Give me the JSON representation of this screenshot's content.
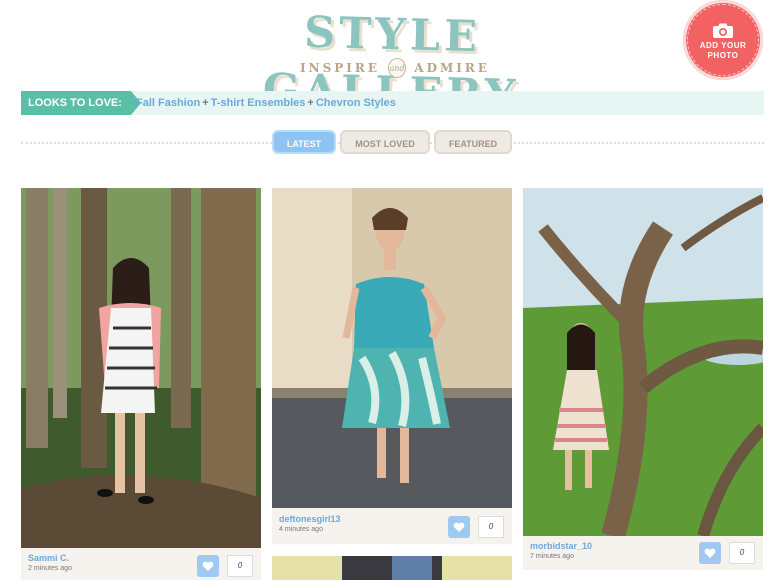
{
  "header": {
    "title": "STYLE GALLERY",
    "tagline_left": "INSPIRE",
    "tagline_mid": "and",
    "tagline_right": "ADMIRE"
  },
  "add_photo": {
    "label": "ADD YOUR PHOTO",
    "icon": "camera-icon"
  },
  "looks": {
    "label": "LOOKS TO LOVE:",
    "links": [
      "Fall Fashion",
      "T-shirt Ensembles",
      "Chevron Styles"
    ],
    "separator": "+"
  },
  "tabs": [
    {
      "label": "LATEST",
      "active": true
    },
    {
      "label": "MOST LOVED",
      "active": false
    },
    {
      "label": "FEATURED",
      "active": false
    }
  ],
  "cards": [
    {
      "user": "Sammi C.",
      "time": "2 minutes ago",
      "loves": "0"
    },
    {
      "user": "deftonesgirl13",
      "time": "4 minutes ago",
      "loves": "0"
    },
    {
      "user": "morbidstar_10",
      "time": "7 minutes ago",
      "loves": "0"
    }
  ],
  "colors": {
    "title": "#8cc5c0",
    "accent_teal": "#5bbfa7",
    "link_blue": "#6ca8d8",
    "badge_red": "#f26262",
    "tab_active": "#8fc4f2"
  }
}
